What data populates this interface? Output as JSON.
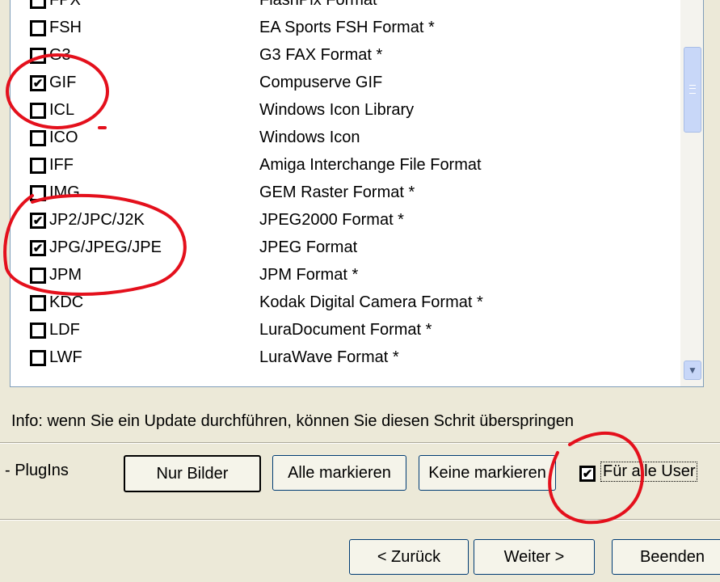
{
  "formats": [
    {
      "code": "FPX",
      "description": "FlashPix Format *",
      "checked": false
    },
    {
      "code": "FSH",
      "description": "EA Sports FSH Format *",
      "checked": false
    },
    {
      "code": "G3",
      "description": "G3 FAX Format *",
      "checked": false
    },
    {
      "code": "GIF",
      "description": "Compuserve GIF",
      "checked": true
    },
    {
      "code": "ICL",
      "description": "Windows Icon Library",
      "checked": false
    },
    {
      "code": "ICO",
      "description": "Windows Icon",
      "checked": false
    },
    {
      "code": "IFF",
      "description": "Amiga Interchange File Format",
      "checked": false
    },
    {
      "code": "IMG",
      "description": "GEM Raster Format *",
      "checked": false
    },
    {
      "code": "JP2/JPC/J2K",
      "description": "JPEG2000 Format *",
      "checked": true
    },
    {
      "code": "JPG/JPEG/JPE",
      "description": "JPEG Format",
      "checked": true
    },
    {
      "code": "JPM",
      "description": "JPM Format *",
      "checked": false
    },
    {
      "code": "KDC",
      "description": "Kodak Digital Camera Format *",
      "checked": false
    },
    {
      "code": "LDF",
      "description": "LuraDocument Format *",
      "checked": false
    },
    {
      "code": "LWF",
      "description": "LuraWave Format *",
      "checked": false
    }
  ],
  "info_text": "Info: wenn Sie ein Update durchführen, können Sie diesen Schrit überspringen",
  "plugins_label": "- PlugIns",
  "buttons": {
    "only_images": "Nur Bilder",
    "select_all": "Alle markieren",
    "select_none": "Keine markieren"
  },
  "all_users": {
    "label": "Für alle User",
    "checked": true
  },
  "nav": {
    "back": "< Zurück",
    "next": "Weiter >",
    "finish": "Beenden"
  },
  "colors": {
    "annotation_red": "#e4101c",
    "window_bg": "#ece9d8"
  },
  "icons": {
    "scroll_down": "chevron-down-icon",
    "check": "check-icon"
  }
}
